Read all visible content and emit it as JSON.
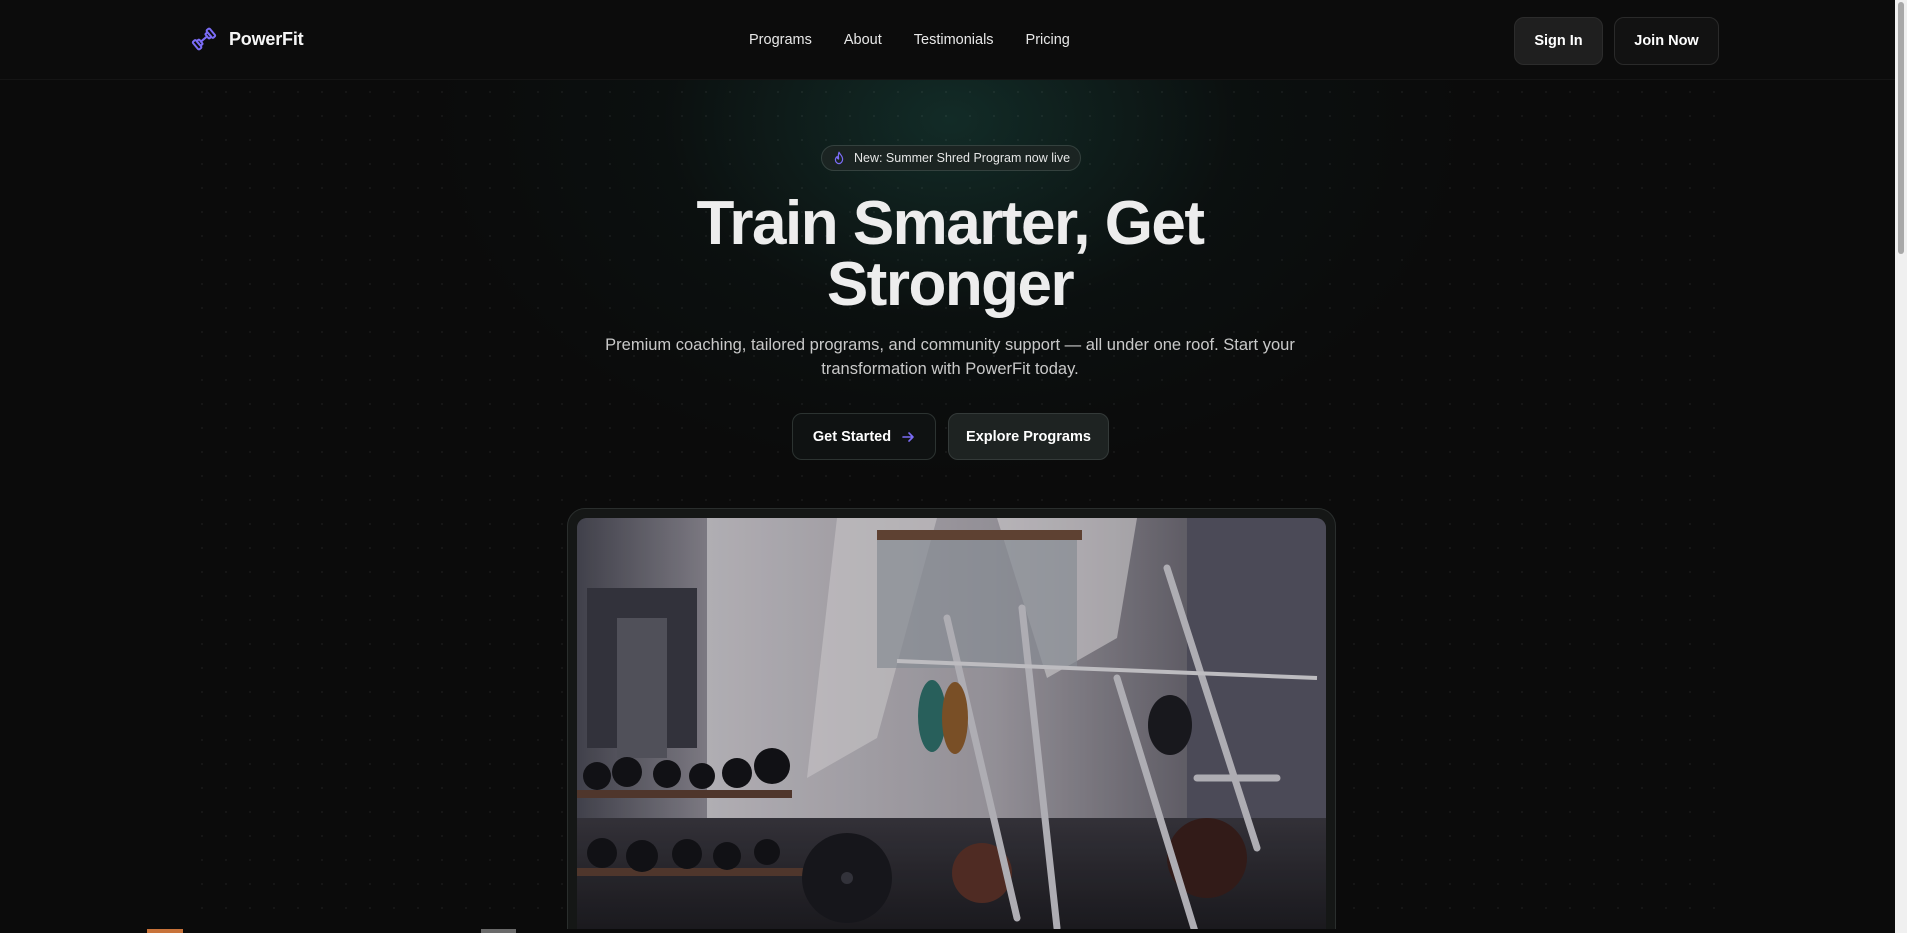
{
  "brand": {
    "name": "PowerFit",
    "icon": "dumbbell-icon",
    "accent": "#7b6cf6"
  },
  "nav": {
    "links": [
      {
        "label": "Programs"
      },
      {
        "label": "About"
      },
      {
        "label": "Testimonials"
      },
      {
        "label": "Pricing"
      }
    ],
    "sign_in_label": "Sign In",
    "join_label": "Join Now"
  },
  "hero": {
    "announcement": "New: Summer Shred Program now live",
    "announcement_icon": "flame-icon",
    "headline_line1": "Train Smarter, Get",
    "headline_line2": "Stronger",
    "subtitle": "Premium coaching, tailored programs, and community support — all under one roof. Start your transformation with PowerFit today.",
    "cta_primary": "Get Started",
    "cta_primary_icon": "arrow-right-icon",
    "cta_secondary": "Explore Programs"
  },
  "colors": {
    "background": "#0b0b0b",
    "hero_glow": "#18463e",
    "text": "#ededed",
    "muted_text": "#c9c9c9"
  }
}
